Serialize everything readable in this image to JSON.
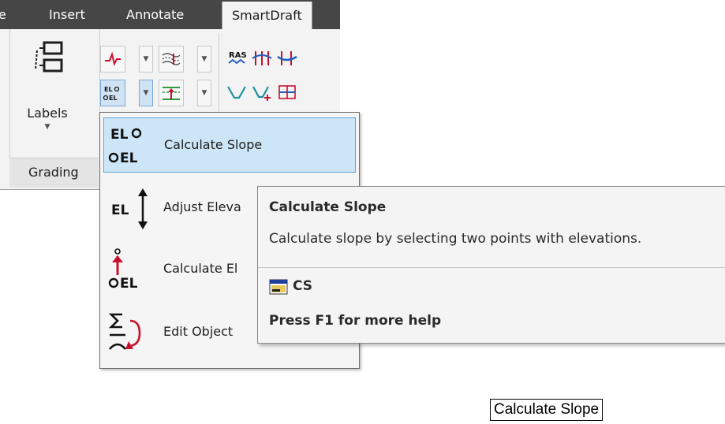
{
  "ribbon": {
    "tabs": [
      {
        "label": "e"
      },
      {
        "label": "Insert"
      },
      {
        "label": "Annotate"
      },
      {
        "label": "SmartDraft",
        "active": true
      }
    ],
    "labels_button": "Labels",
    "group_label": "Grading"
  },
  "menu": {
    "items": [
      {
        "label": "Calculate Slope",
        "icon": "elevation-slope-icon",
        "highlighted": true
      },
      {
        "label": "Adjust Eleva",
        "icon": "adjust-elevation-icon"
      },
      {
        "label": "Calculate El",
        "icon": "calculate-elevation-icon"
      },
      {
        "label": "Edit Object",
        "icon": "edit-object-icon"
      }
    ]
  },
  "tooltip": {
    "title": "Calculate Slope",
    "description": "Calculate slope by selecting two points with elevations.",
    "command": "CS",
    "help": "Press F1 for more help"
  },
  "floating_label": "Calculate Slope",
  "colors": {
    "tab_bar": "#464646",
    "ribbon": "#f3f3f3",
    "highlight": "#cde6f7",
    "highlight_border": "#5ea4da",
    "icon_red": "#c8102e",
    "icon_blue": "#1f5fbf",
    "icon_green": "#2e9a3a"
  }
}
